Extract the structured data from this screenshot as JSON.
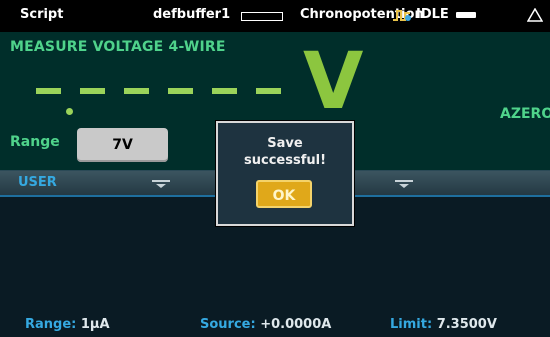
{
  "statusbar": {
    "script": "Script",
    "buffer": "defbuffer1",
    "app": "Chronopotention",
    "state": "IDLE"
  },
  "measure": {
    "title": "MEASURE VOLTAGE 4-WIRE",
    "unit": "V",
    "azero": "AZERO",
    "range_label": "Range",
    "range_value": "7V"
  },
  "panel": {
    "tab_label": "USER",
    "range_label": "Range:",
    "range_value": "1μA",
    "source_label": "Source:",
    "source_value": "+0.0000A",
    "limit_label": "Limit:",
    "limit_value": "7.3500V"
  },
  "dialog": {
    "line1": "Save",
    "line2": "successful!",
    "ok_label": "OK"
  },
  "colors": {
    "measure_bg": "#002e2a",
    "reading_green": "#8cc63f",
    "title_green": "#4fd38b",
    "accent_blue": "#35a9e1",
    "ok_yellow": "#e0a81a"
  },
  "icons": [
    "trigger-icon",
    "battery-icon",
    "warning-icon",
    "expand-caret-icon"
  ]
}
